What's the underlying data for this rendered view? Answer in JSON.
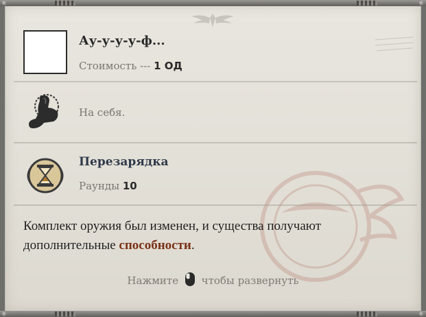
{
  "ability": {
    "title": "Ау-у-у-у-ф...",
    "cost_label": "Стоимость --- ",
    "cost_value": "1 ОД"
  },
  "target": {
    "icon": "flexed-arm-icon",
    "label": "На себя."
  },
  "cooldown": {
    "icon": "hourglass-icon",
    "title": "Перезарядка",
    "rounds_label": "Раунды ",
    "rounds_value": "10"
  },
  "description": {
    "text_before": "Комплект оружия был изменен, и существа получают дополнительные ",
    "highlight": "способности",
    "text_after": "."
  },
  "hint": {
    "before": "Нажмите",
    "icon": "mouse-icon",
    "after": "чтобы развернуть"
  },
  "colors": {
    "highlight": "#7a3216",
    "panel_bg": "#e6e3dc",
    "frame": "#6e6e6b"
  }
}
